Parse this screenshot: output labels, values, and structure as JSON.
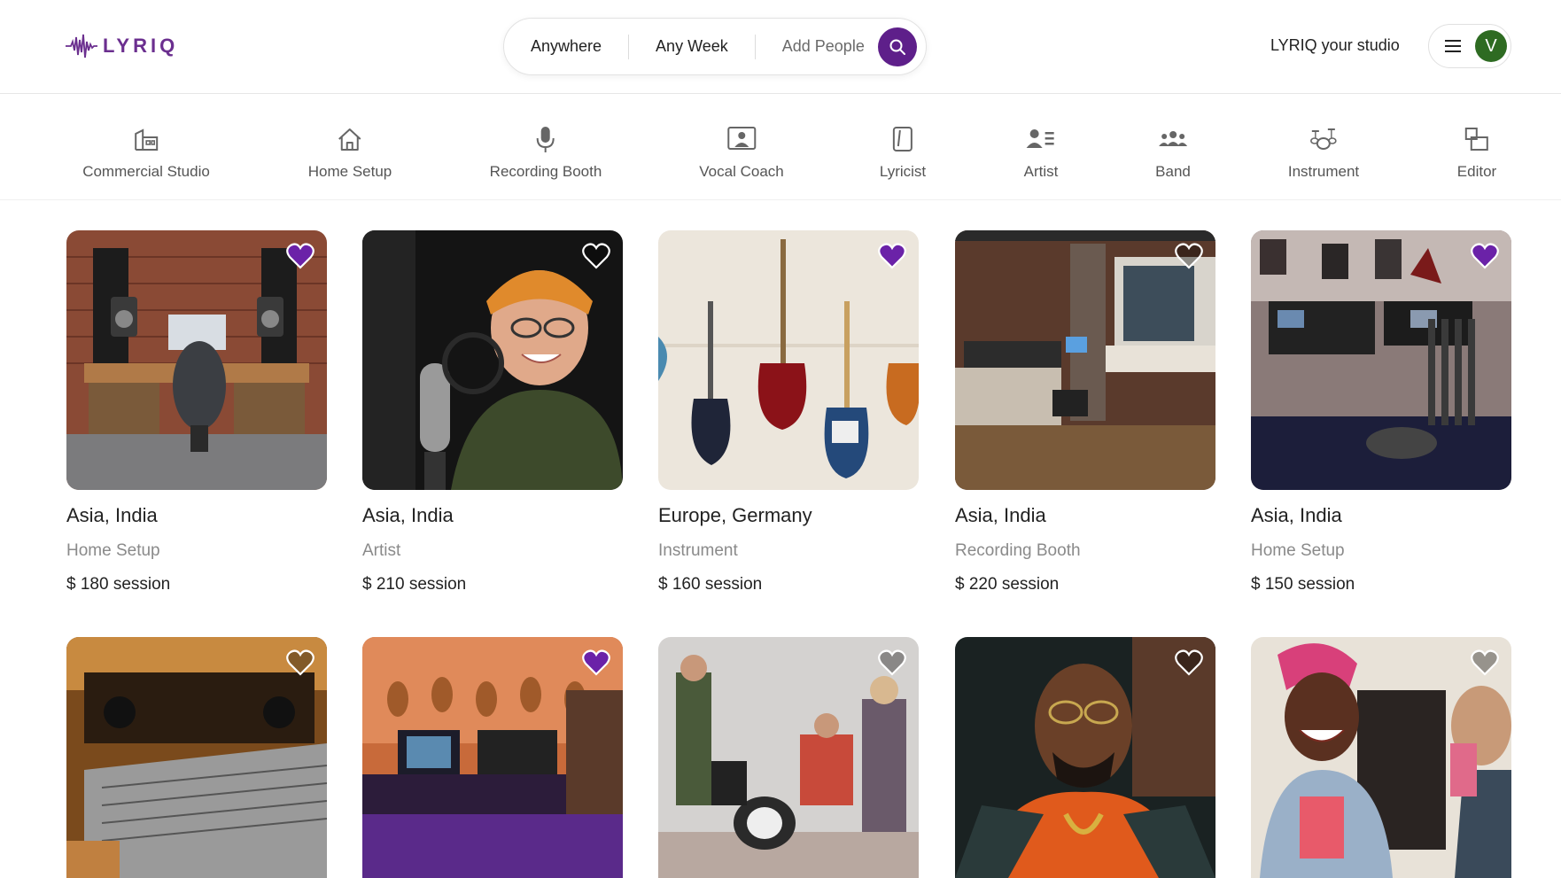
{
  "brand": {
    "name": "LYRIQ",
    "accent": "#5e1f8a",
    "logo_icon": "waveform-icon"
  },
  "search": {
    "where": "Anywhere",
    "when": "Any Week",
    "who": "Add People",
    "button_icon": "search-icon"
  },
  "header": {
    "host_link": "LYRIQ your studio",
    "menu_icon": "hamburger-icon",
    "avatar_initial": "V"
  },
  "categories": [
    {
      "label": "Commercial Studio",
      "icon": "building-icon"
    },
    {
      "label": "Home Setup",
      "icon": "home-icon"
    },
    {
      "label": "Recording Booth",
      "icon": "microphone-icon"
    },
    {
      "label": "Vocal Coach",
      "icon": "person-screen-icon"
    },
    {
      "label": "Lyricist",
      "icon": "notebook-pen-icon"
    },
    {
      "label": "Artist",
      "icon": "person-list-icon"
    },
    {
      "label": "Band",
      "icon": "group-icon"
    },
    {
      "label": "Instrument",
      "icon": "drum-kit-icon"
    },
    {
      "label": "Editor",
      "icon": "editor-panels-icon"
    }
  ],
  "listings": [
    {
      "location": "Asia, India",
      "category": "Home Setup",
      "price": "$ 180",
      "unit": "session",
      "favorited": true,
      "scene": "studio-desk"
    },
    {
      "location": "Asia, India",
      "category": "Artist",
      "price": "$ 210",
      "unit": "session",
      "favorited": false,
      "scene": "singer"
    },
    {
      "location": "Europe, Germany",
      "category": "Instrument",
      "price": "$ 160",
      "unit": "session",
      "favorited": true,
      "scene": "guitars-wall"
    },
    {
      "location": "Asia, India",
      "category": "Recording Booth",
      "price": "$ 220",
      "unit": "session",
      "favorited": false,
      "scene": "booth-room"
    },
    {
      "location": "Asia, India",
      "category": "Home Setup",
      "price": "$ 150",
      "unit": "session",
      "favorited": true,
      "scene": "gear-room"
    },
    {
      "favorited": false,
      "scene": "mixing-console"
    },
    {
      "favorited": true,
      "scene": "neon-studio"
    },
    {
      "favorited": false,
      "scene": "band-rehearsal"
    },
    {
      "favorited": false,
      "scene": "portrait-man"
    },
    {
      "favorited": false,
      "scene": "laughing-duo"
    }
  ]
}
